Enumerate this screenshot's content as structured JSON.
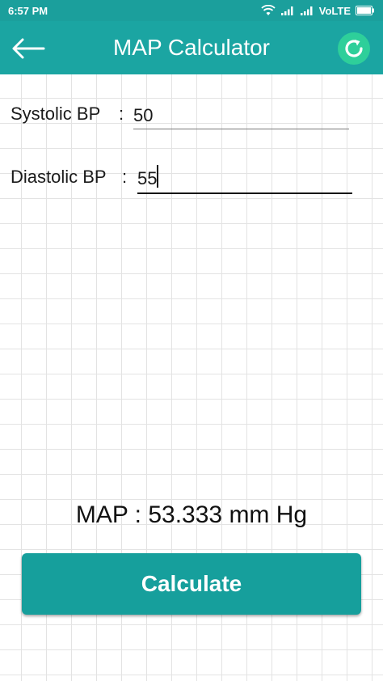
{
  "status_bar": {
    "time": "6:57 PM",
    "network_label": "VoLTE",
    "icons": [
      "wifi-icon",
      "signal-icon",
      "signal-icon",
      "battery-icon"
    ]
  },
  "app_bar": {
    "title": "MAP Calculator",
    "back_icon": "arrow-left-icon",
    "refresh_icon": "refresh-icon",
    "color": "#1ba5a2",
    "refresh_color": "#2ecf9a"
  },
  "form": {
    "systolic_label": "Systolic BP",
    "systolic_sep": ":",
    "systolic_value": "50",
    "diastolic_label": "Diastolic BP",
    "diastolic_sep": ":",
    "diastolic_value": "55"
  },
  "result": {
    "text": "MAP : 53.333 mm Hg"
  },
  "calculate_button": {
    "label": "Calculate",
    "color": "#169f9c"
  }
}
